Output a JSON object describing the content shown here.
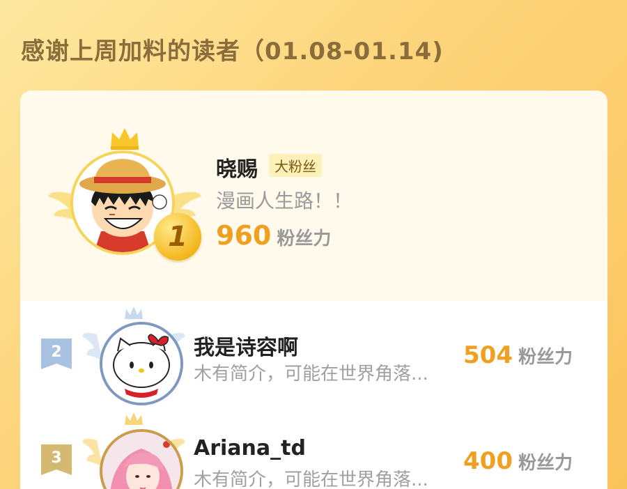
{
  "header": {
    "title": "感谢上周加料的读者（01.08-01.14)"
  },
  "colors": {
    "accent": "#f0a020",
    "title": "#8a6d3b",
    "background_from": "#fde8a0",
    "background_to": "#fbc35c"
  },
  "leaderboard": {
    "first": {
      "rank": "1",
      "name": "晓赐",
      "badge": "大粉丝",
      "bio": "漫画人生路！！",
      "score": "960",
      "score_unit": "粉丝力",
      "avatar": "one-piece-luffy-avatar"
    },
    "entries": [
      {
        "rank": "2",
        "name": "我是诗容啊",
        "bio": "木有简介，可能在世界角落...",
        "score": "504",
        "score_unit": "粉丝力",
        "avatar": "hello-kitty-avatar"
      },
      {
        "rank": "3",
        "name": "Ariana_td",
        "bio": "木有简介，可能在世界角落...",
        "score": "400",
        "score_unit": "粉丝力",
        "avatar": "pink-hair-girl-avatar"
      }
    ]
  }
}
